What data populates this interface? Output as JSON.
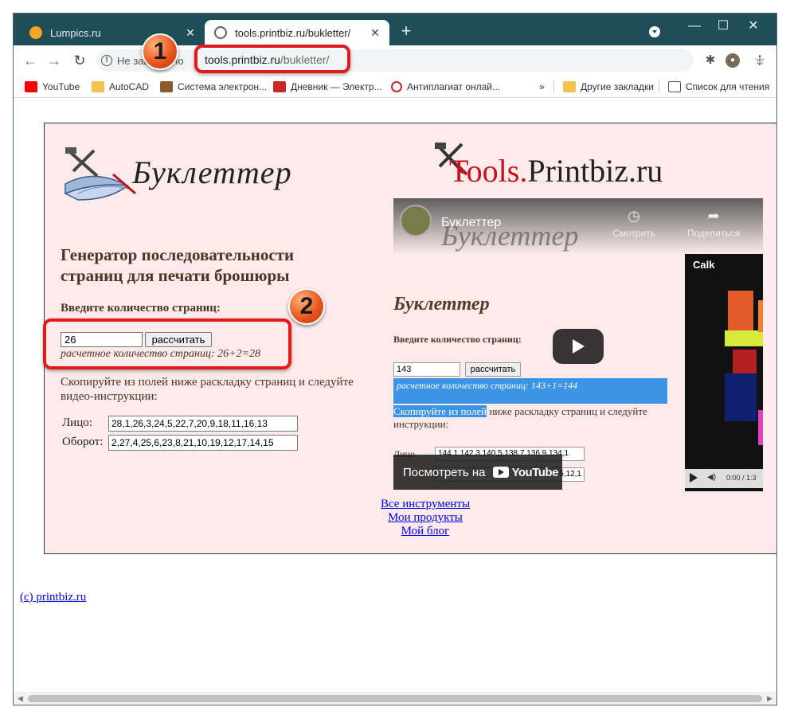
{
  "browser": {
    "tabs": [
      {
        "title": "Lumpics.ru",
        "active": false
      },
      {
        "title": "tools.printbiz.ru/bukletter/",
        "active": true
      }
    ],
    "new_tab": "+",
    "window_controls": {
      "minimize": "—",
      "maximize": "☐",
      "close": "✕"
    },
    "tab_close": "✕",
    "nav": {
      "back": "←",
      "forward": "→",
      "reload": "↻"
    },
    "security_chip": "Не защищено",
    "url": {
      "host": "tools.printbiz.ru",
      "path": "/bukletter/"
    },
    "bookmarks": [
      {
        "label": "YouTube",
        "color": "#ff0000"
      },
      {
        "label": "AutoCAD",
        "color": "#f2c14e"
      },
      {
        "label": "Система электрон...",
        "color": "#8a5a2a"
      },
      {
        "label": "Дневник — Электр...",
        "color": "#c62828"
      },
      {
        "label": "Антиплагиат онлай...",
        "color": "#c62828"
      }
    ],
    "bookmarks_overflow": "»",
    "other_bookmarks": "Другие закладки",
    "reading_list": "Список для чтения"
  },
  "page": {
    "logo_left": "Буклеттер",
    "logo_right_red": "Tools.",
    "logo_right_dark": "Printbiz.ru",
    "title": "Генератор последовательности страниц для печати брошюры",
    "pages_label": "Введите количество страниц:",
    "pages_value": "26",
    "calc_button": "рассчитать",
    "calc_result": "расчетное количество страниц: 26+2=28",
    "instructions": "Скопируйте из полей ниже раскладку страниц и следуйте видео-инструкции:",
    "front_label": "Лицо:",
    "front_value": "28,1,26,3,24,5,22,7,20,9,18,11,16,13",
    "back_label": "Оборот:",
    "back_value": "2,27,4,25,6,23,8,21,10,19,12,17,14,15",
    "links": [
      "Все инструменты",
      "Мои продукты",
      "Мой блог"
    ],
    "copyright": "(c) printbiz.ru"
  },
  "video": {
    "title": "Буклеттер",
    "watch_later": "Смотреть",
    "share": "Поделиться",
    "heading": "Буклеттер",
    "pages_label": "Введите количество страниц:",
    "pages_value": "143",
    "calc_button": "рассчитать",
    "result": "расчетное количество страниц: 143+1=144",
    "instr_highlight": "Скопируйте из полей",
    "instr_rest": " ниже раскладку страниц и следуйте инструкции:",
    "row_label": "Лицо",
    "row1_value": "144,1,142,3,140,5,138,7,136,9,134,1",
    "row2_value": "5,12,1",
    "calk_title": "Calk",
    "calk_time": "0:00 / 1:3",
    "watch_on": "Посмотреть на",
    "yt_brand": "YouTube"
  },
  "annotations": {
    "badge1": "1",
    "badge2": "2",
    "accent": "#e01b1b"
  }
}
